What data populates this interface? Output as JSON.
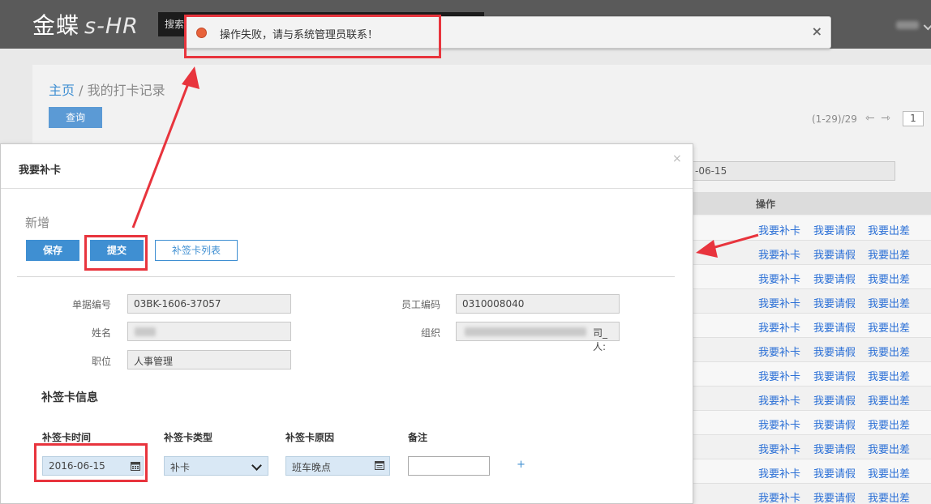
{
  "header": {
    "logo_main": "金蝶",
    "logo_sub": "s-HR",
    "search_placeholder": "搜索服务、员工、组织、岗位",
    "search_icon": "search-icon",
    "org_icon": "org-chart-icon"
  },
  "notification": {
    "message": "操作失败，请与系统管理员联系！",
    "close": "×",
    "dot_color": "#e8623a"
  },
  "breadcrumb": {
    "home": "主页",
    "separator": "/",
    "current": "我的打卡记录"
  },
  "query_button": "查询",
  "pager": {
    "range": "(1-29)/29",
    "prev": "⇽",
    "next": "⇾",
    "page": "1"
  },
  "filter": {
    "date_visible": "-06-15"
  },
  "table": {
    "op_header": "操作",
    "actions": [
      "我要补卡",
      "我要请假",
      "我要出差"
    ],
    "row_count": 12,
    "link_color": "#2a6fd6"
  },
  "dialog": {
    "title": "我要补卡",
    "close": "×",
    "state": "新增",
    "buttons": {
      "save": "保存",
      "submit": "提交",
      "list": "补签卡列表"
    },
    "fields": {
      "bill_no_label": "单据编号",
      "bill_no": "03BK-1606-37057",
      "emp_code_label": "员工编码",
      "emp_code": "0310008040",
      "name_label": "姓名",
      "org_label": "组织",
      "org_tail": "司_人:",
      "position_label": "职位",
      "position": "人事管理"
    },
    "section_title": "补签卡信息",
    "columns": {
      "time": "补签卡时间",
      "type": "补签卡类型",
      "reason": "补签卡原因",
      "remark": "备注"
    },
    "entry": {
      "time": "2016-06-15",
      "type": "补卡",
      "reason": "班车晚点",
      "remark": "",
      "add": "+"
    }
  },
  "highlight_color": "#e8343d",
  "accent_color": "#3f8fd2"
}
